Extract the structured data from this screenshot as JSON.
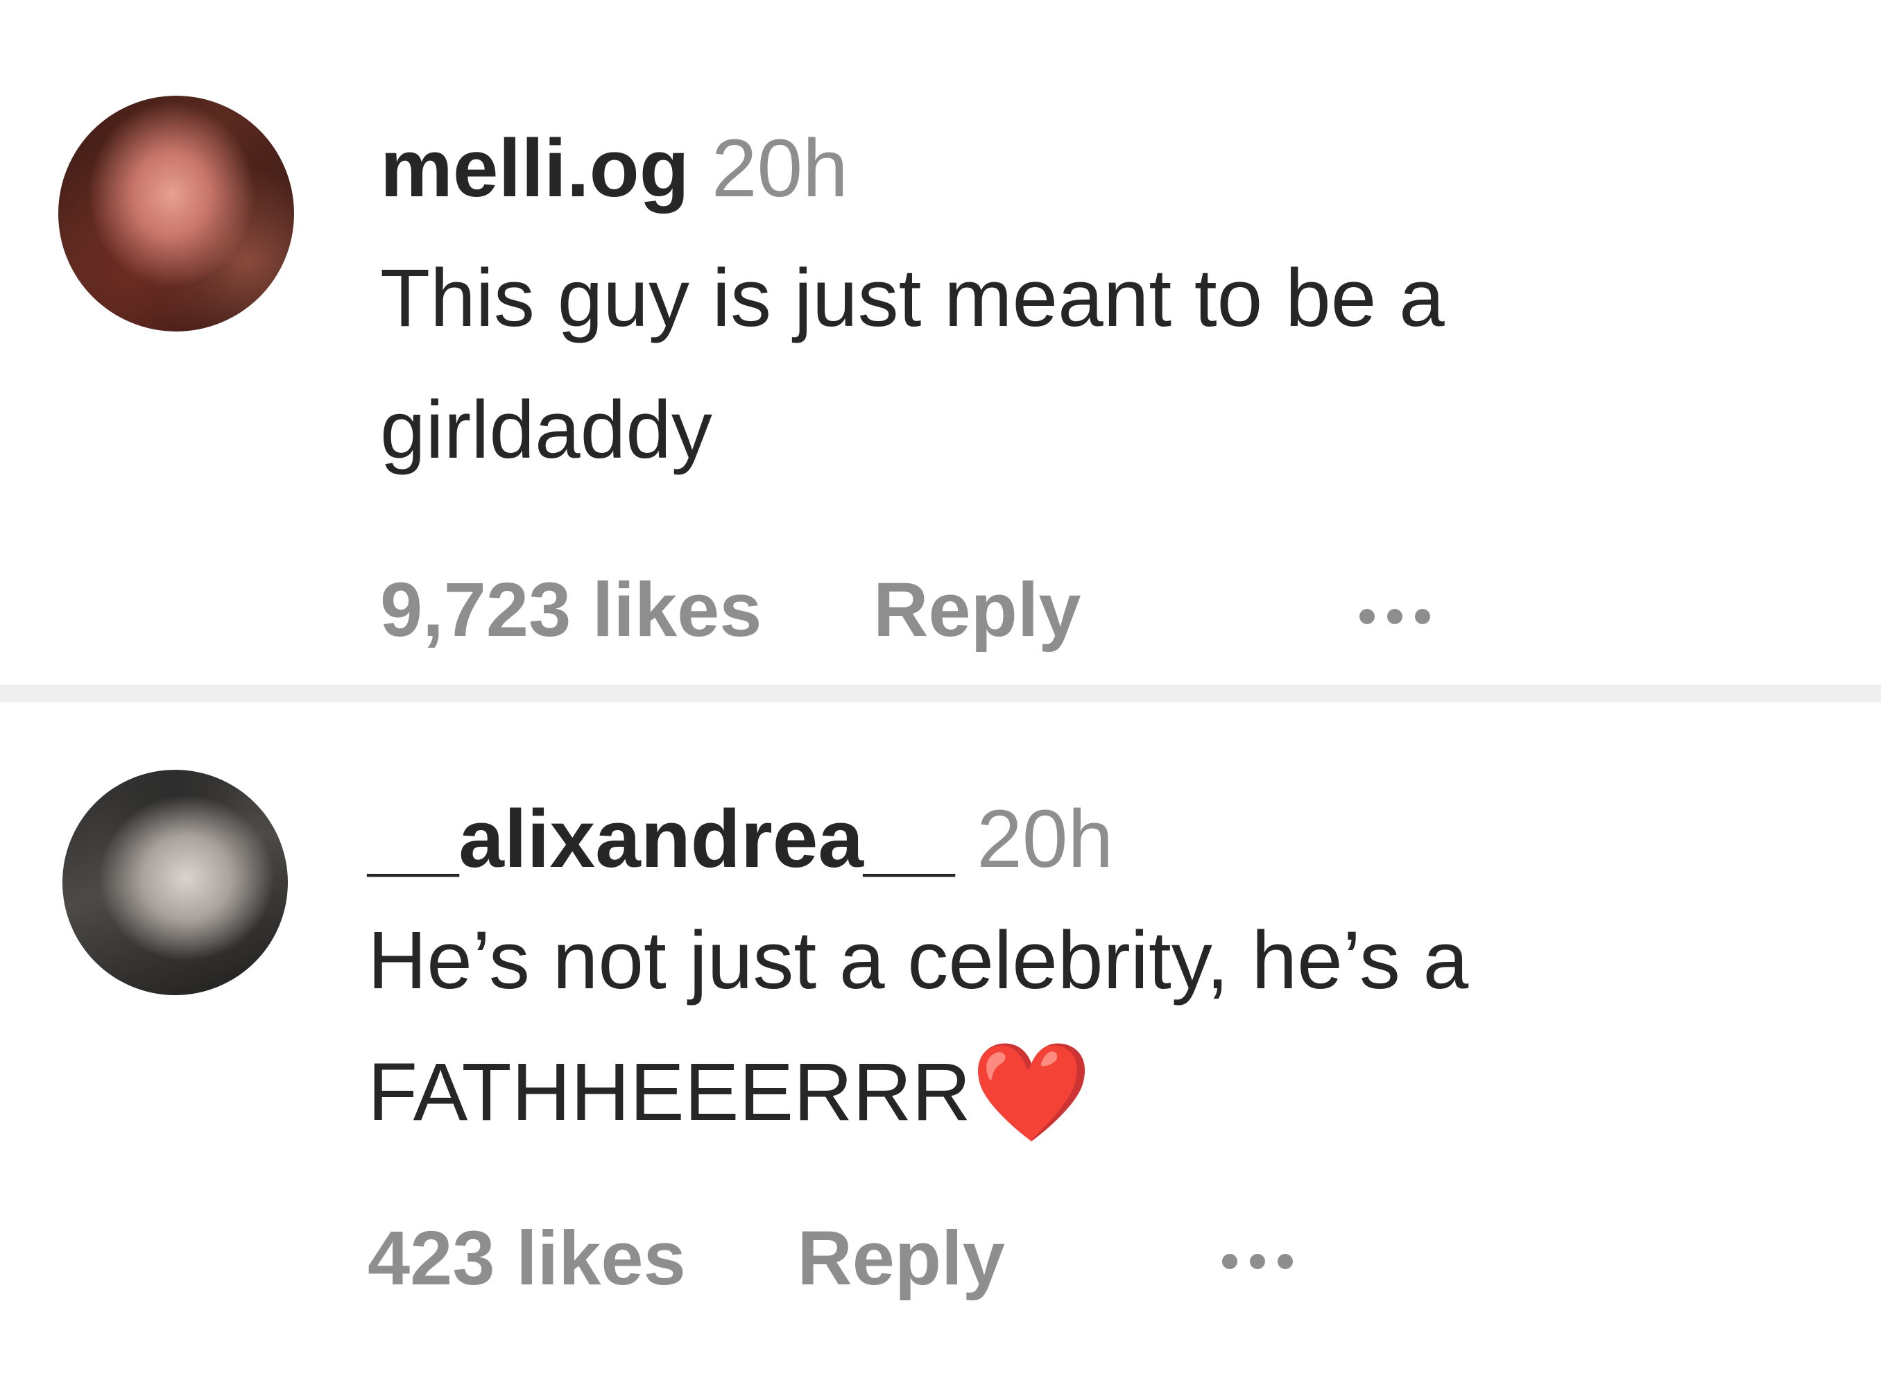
{
  "comments": [
    {
      "username": "melli.og",
      "time": "20h",
      "text_line1": "This guy is just meant to be a",
      "text_line2": "girldaddy",
      "emoji": "",
      "likes": "9,723 likes",
      "reply_label": "Reply",
      "more_icon": "more-options-icon"
    },
    {
      "username": "__alixandrea__",
      "time": "20h",
      "text_line1": "He’s not just a celebrity, he’s a",
      "text_line2": "FATHHEEERRR",
      "emoji": "❤️",
      "likes": "423 likes",
      "reply_label": "Reply",
      "more_icon": "more-options-icon"
    }
  ],
  "colors": {
    "primary_text": "#262626",
    "secondary_text": "#8e8e8e",
    "divider": "#efefef",
    "heart": "#e0203b"
  }
}
